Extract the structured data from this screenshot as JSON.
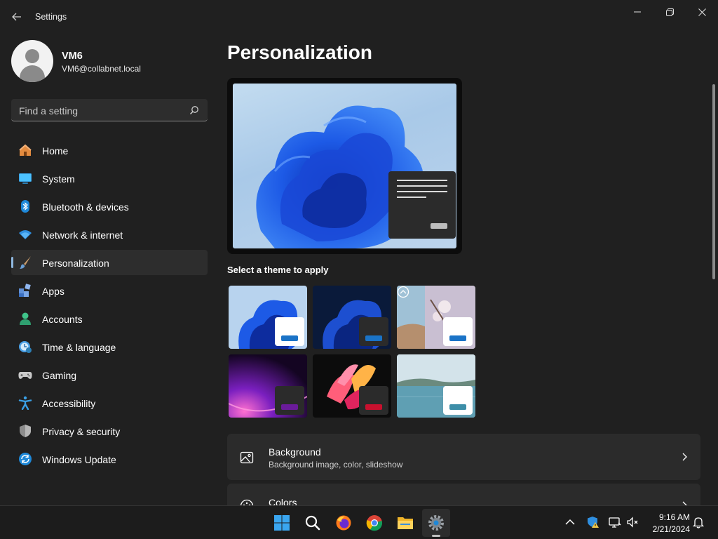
{
  "window": {
    "title": "Settings"
  },
  "profile": {
    "name": "VM6",
    "email": "VM6@collabnet.local"
  },
  "search": {
    "placeholder": "Find a setting"
  },
  "nav": {
    "items": [
      {
        "label": "Home",
        "icon": "home-icon",
        "active": false
      },
      {
        "label": "System",
        "icon": "system-icon",
        "active": false
      },
      {
        "label": "Bluetooth & devices",
        "icon": "bluetooth-icon",
        "active": false
      },
      {
        "label": "Network & internet",
        "icon": "network-icon",
        "active": false
      },
      {
        "label": "Personalization",
        "icon": "brush-icon",
        "active": true
      },
      {
        "label": "Apps",
        "icon": "apps-icon",
        "active": false
      },
      {
        "label": "Accounts",
        "icon": "accounts-icon",
        "active": false
      },
      {
        "label": "Time & language",
        "icon": "time-language-icon",
        "active": false
      },
      {
        "label": "Gaming",
        "icon": "gaming-icon",
        "active": false
      },
      {
        "label": "Accessibility",
        "icon": "accessibility-icon",
        "active": false
      },
      {
        "label": "Privacy & security",
        "icon": "shield-icon",
        "active": false
      },
      {
        "label": "Windows Update",
        "icon": "windows-update-icon",
        "active": false
      }
    ]
  },
  "main": {
    "title": "Personalization",
    "theme_section_label": "Select a theme to apply",
    "themes": [
      {
        "name": "light-bloom-theme",
        "button_color": "#1a73c7",
        "window_color": "#ffffff"
      },
      {
        "name": "dark-bloom-theme",
        "button_color": "#1a73c7",
        "window_color": "#2b2b2b"
      },
      {
        "name": "spotlight-theme",
        "button_color": "#1a73c7",
        "window_color": "#ffffff"
      },
      {
        "name": "glow-theme",
        "button_color": "#6a1b9a",
        "window_color": "#2b2b2b"
      },
      {
        "name": "captured-motion-theme",
        "button_color": "#c8102e",
        "window_color": "#2b2b2b"
      },
      {
        "name": "flow-theme",
        "button_color": "#3d8ea8",
        "window_color": "#ffffff"
      }
    ],
    "cards": [
      {
        "title": "Background",
        "subtitle": "Background image, color, slideshow",
        "icon": "image-icon"
      },
      {
        "title": "Colors",
        "subtitle": "",
        "icon": "palette-icon"
      }
    ]
  },
  "taskbar": {
    "apps": [
      "start-icon",
      "search-icon",
      "firefox-icon",
      "chrome-icon",
      "file-explorer-icon",
      "settings-icon"
    ],
    "time": "9:16 AM",
    "date": "2/21/2024"
  },
  "colors": {
    "accent": "#60cdff",
    "background": "#202020",
    "card": "#2b2b2b"
  }
}
